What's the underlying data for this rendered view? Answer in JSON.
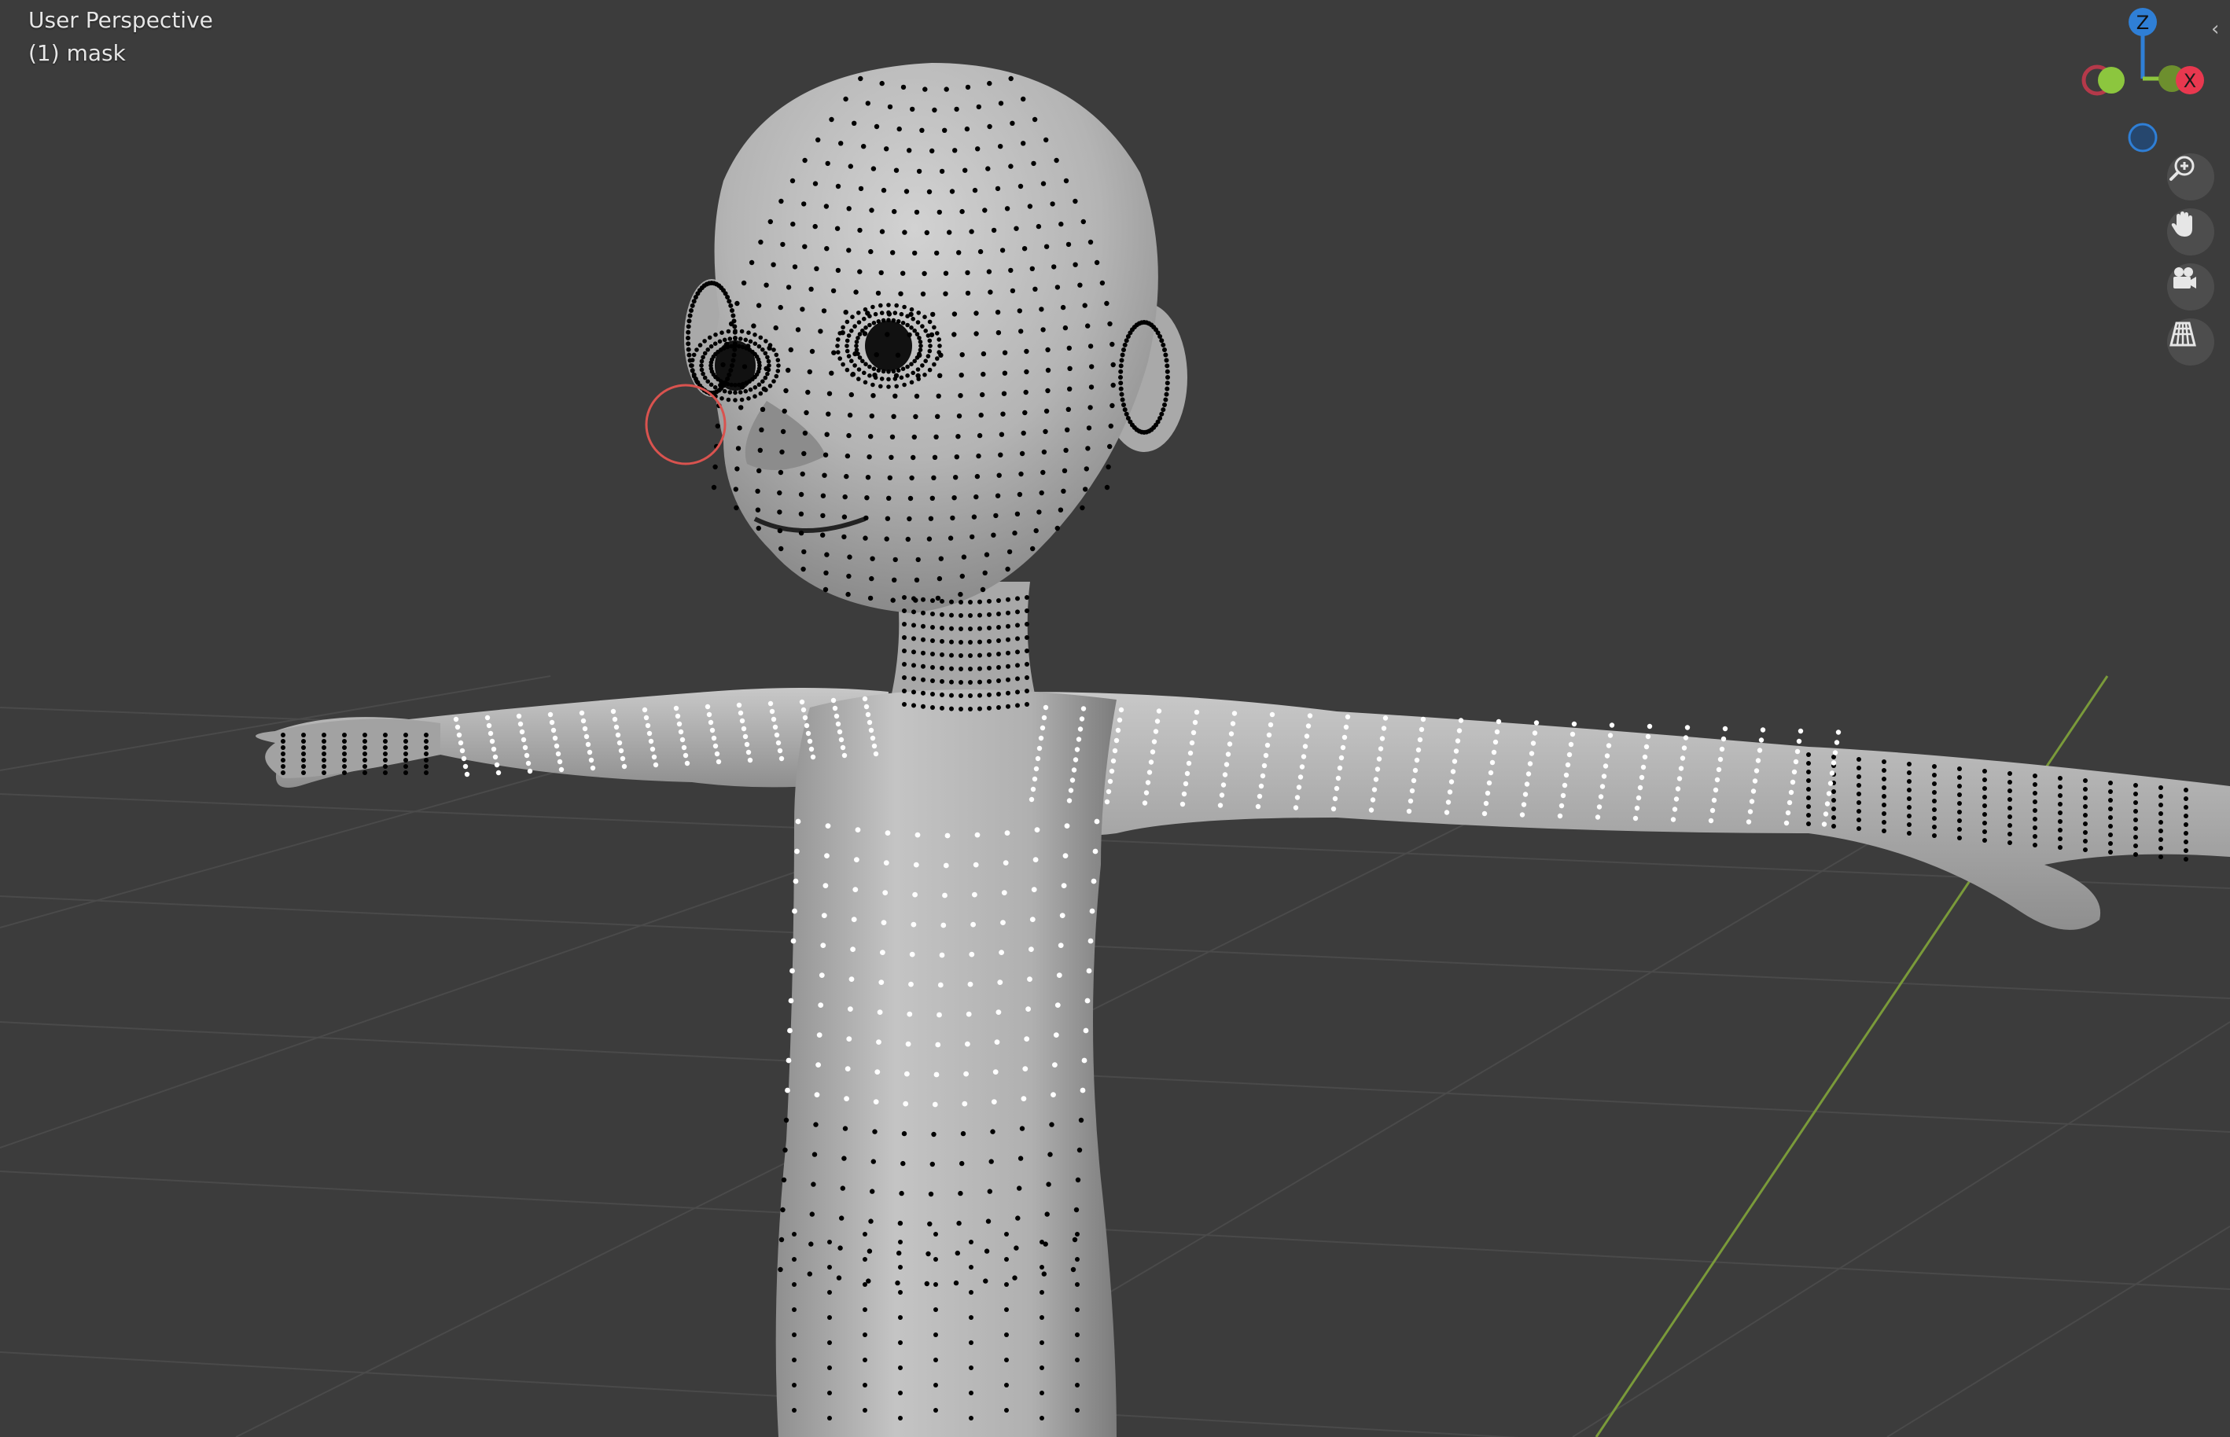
{
  "viewport": {
    "view_label": "User Perspective",
    "object_label": "(1) mask"
  },
  "gizmo": {
    "z_label": "Z",
    "x_label": "X",
    "colors": {
      "x": "#e8384f",
      "y": "#8cc63e",
      "z": "#2f7fd6"
    }
  },
  "nav_buttons": [
    {
      "name": "zoom",
      "icon": "zoom-in-icon"
    },
    {
      "name": "pan",
      "icon": "hand-icon"
    },
    {
      "name": "camera",
      "icon": "camera-icon"
    },
    {
      "name": "perspective",
      "icon": "perspective-grid-icon"
    }
  ],
  "colors": {
    "background": "#3c3c3c",
    "grid": "#4a4a4a",
    "y_axis": "#7a9a3a",
    "mesh": "#bdbdbd",
    "mask_dot": "#000000",
    "unmasked_dot": "#ffffff",
    "brush_cursor": "#d9534f"
  }
}
